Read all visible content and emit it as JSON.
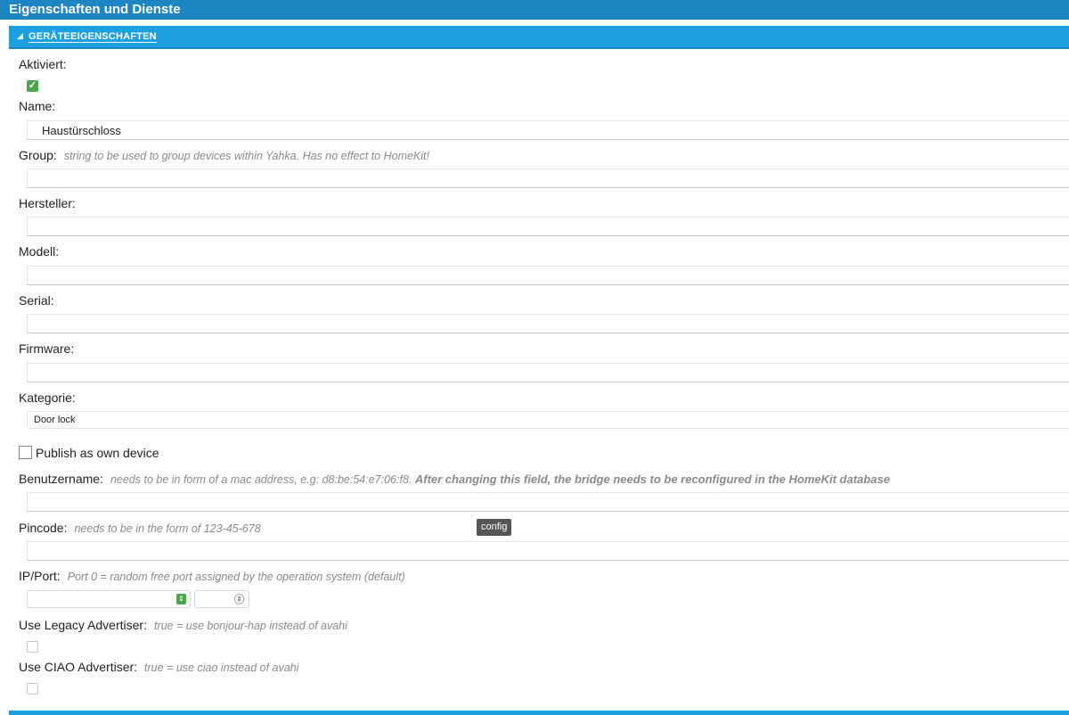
{
  "window": {
    "title": "Eigenschaften und Dienste"
  },
  "section": {
    "title": "GERÄTEEIGENSCHAFTEN"
  },
  "fields": {
    "aktiviert": {
      "label": "Aktiviert:",
      "checked": true
    },
    "name": {
      "label": "Name:",
      "value": "Haustürschloss"
    },
    "group": {
      "label": "Group:",
      "hint": "string to be used to group devices within Yahka. Has no effect to HomeKit!",
      "value": ""
    },
    "hersteller": {
      "label": "Hersteller:",
      "value": ""
    },
    "modell": {
      "label": "Modell:",
      "value": ""
    },
    "serial": {
      "label": "Serial:",
      "value": ""
    },
    "firmware": {
      "label": "Firmware:",
      "value": ""
    },
    "kategorie": {
      "label": "Kategorie:",
      "selected": "Door lock"
    },
    "publish": {
      "label": "Publish as own device",
      "checked": false
    },
    "benutzername": {
      "label": "Benutzername:",
      "hint": "needs to be in form of a mac address, e.g: d8:be:54:e7:06:f8.",
      "hint_bold": "After changing this field, the bridge needs to be reconfigured in the HomeKit database",
      "value": ""
    },
    "pincode": {
      "label": "Pincode:",
      "hint": "needs to be in the form of 123-45-678",
      "value": ""
    },
    "ipport": {
      "label": "IP/Port:",
      "hint": "Port 0 = random free port assigned by the operation system (default)"
    },
    "legacy": {
      "label": "Use Legacy Advertiser:",
      "hint": "true = use bonjour-hap instead of avahi",
      "checked": false
    },
    "ciao": {
      "label": "Use CIAO Advertiser:",
      "hint": "true = use ciao instead of avahi",
      "checked": false
    }
  },
  "tooltip": {
    "text": "config"
  },
  "colors": {
    "title_bar": "#1d85c1",
    "section_bar": "#1da0e0",
    "checkbox_green": "#4ca54c"
  }
}
